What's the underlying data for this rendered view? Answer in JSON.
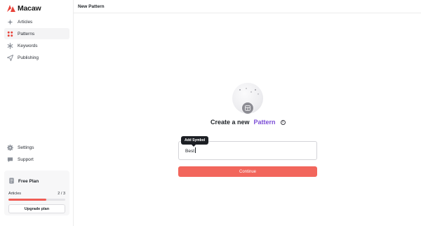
{
  "app": {
    "name": "Macaw"
  },
  "sidebar": {
    "items": [
      {
        "label": "Articles",
        "icon": "sparkle-icon",
        "active": false
      },
      {
        "label": "Patterns",
        "icon": "pattern-icon",
        "active": true
      },
      {
        "label": "Keywords",
        "icon": "asterisk-icon",
        "active": false
      },
      {
        "label": "Publishing",
        "icon": "send-icon",
        "active": false
      }
    ],
    "bottom_items": [
      {
        "label": "Settings",
        "icon": "gear-icon"
      },
      {
        "label": "Support",
        "icon": "chat-icon"
      }
    ]
  },
  "plan": {
    "title": "Free Plan",
    "articles_label": "Articles",
    "articles_count": "2 / 3",
    "articles_fraction": 0.667,
    "upgrade_label": "Upgrade plan"
  },
  "header": {
    "title": "New Pattern"
  },
  "main": {
    "headline_prefix": "Create a new",
    "headline_accent": "Pattern",
    "tooltip": "Add Symbol",
    "input_value": "Best",
    "continue_label": "Continue"
  },
  "colors": {
    "brand": "#e8433a",
    "accent": "#7c4ed6",
    "button": "#f2665c",
    "progress": "#f05d55"
  }
}
